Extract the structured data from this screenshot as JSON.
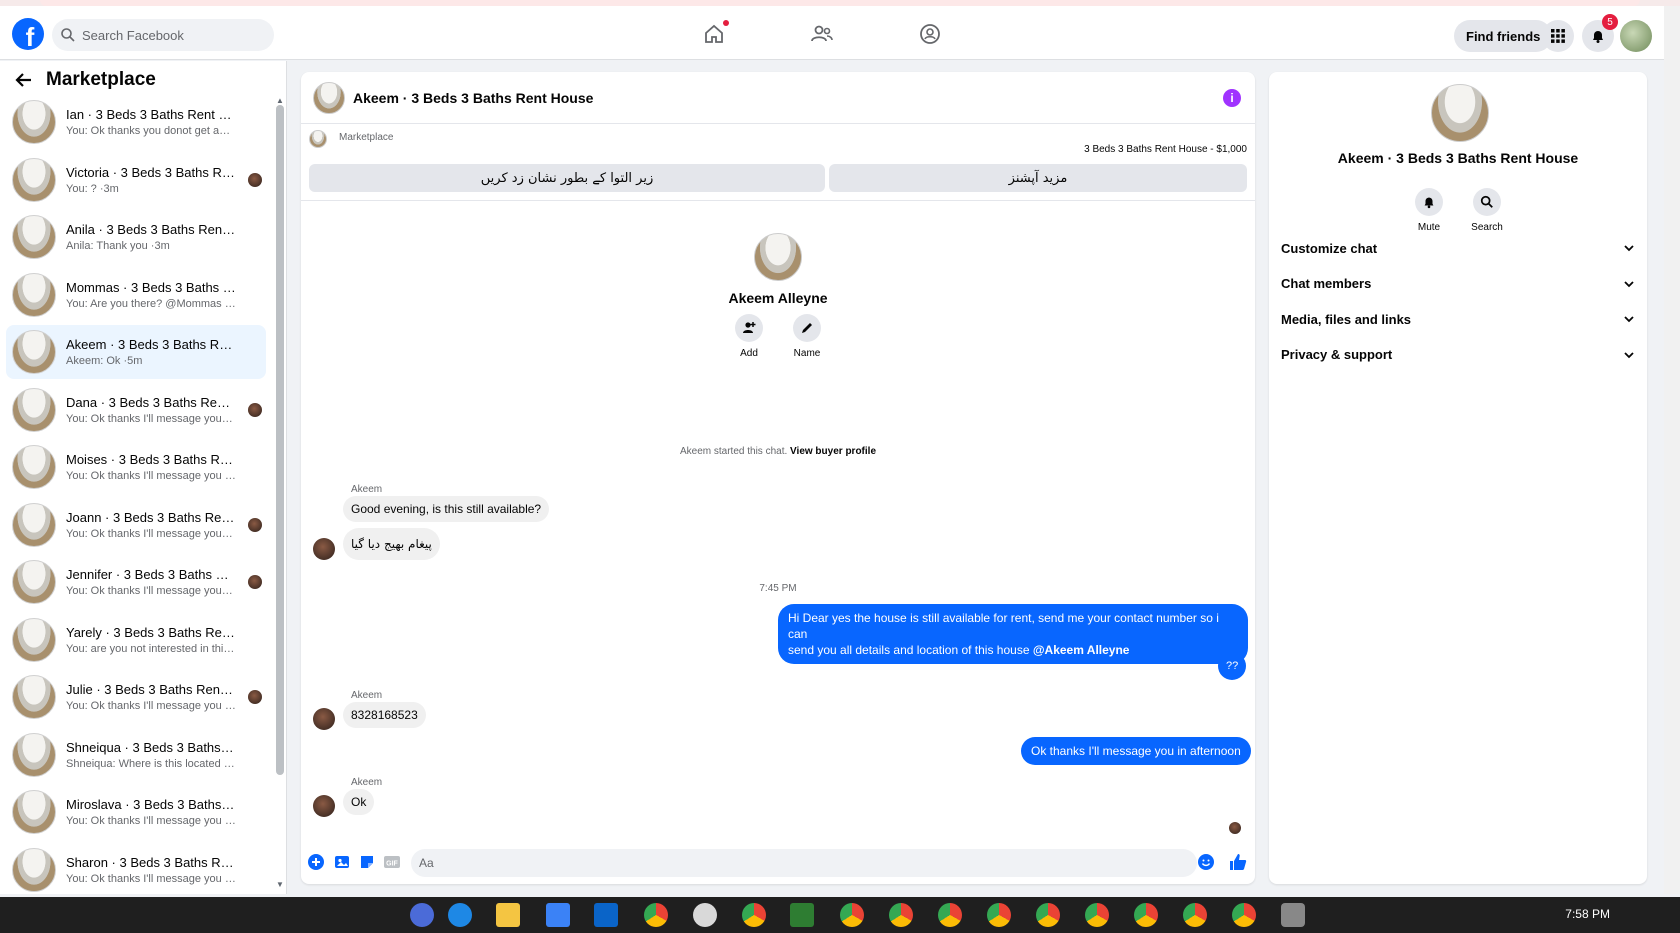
{
  "topnav": {
    "logo_letter": "f",
    "search_placeholder": "Search Facebook",
    "find_friends": "Find friends",
    "notifications_count": "5"
  },
  "left": {
    "title": "Marketplace",
    "conversations": [
      {
        "title": "Ian · 3 Beds 3 Baths Rent House",
        "preview": "You: Ok thanks you donot get any… ·2m",
        "active": false,
        "mini_avatar": false
      },
      {
        "title": "Victoria · 3 Beds 3 Baths Rent…",
        "preview": "You: ? ·3m",
        "active": false,
        "mini_avatar": true
      },
      {
        "title": "Anila · 3 Beds 3 Baths Rent House",
        "preview": "Anila: Thank you ·3m",
        "active": false,
        "mini_avatar": false
      },
      {
        "title": "Mommas · 3 Beds 3 Baths Rent …",
        "preview": "You: Are you there? @Mommas O… ·5m",
        "active": false,
        "mini_avatar": false
      },
      {
        "title": "Akeem · 3 Beds 3 Baths Rent H…",
        "preview": "Akeem: Ok ·5m",
        "active": true,
        "mini_avatar": false
      },
      {
        "title": "Dana · 3 Beds 3 Baths Rent H…",
        "preview": "You: Ok thanks I'll message you… ·9m",
        "active": false,
        "mini_avatar": true
      },
      {
        "title": "Moises · 3 Beds 3 Baths Rent H…",
        "preview": "You: Ok thanks I'll message you in… ·9m",
        "active": false,
        "mini_avatar": false
      },
      {
        "title": "Joann · 3 Beds 3 Baths Rent …",
        "preview": "You: Ok thanks I'll message you… ·7h",
        "active": false,
        "mini_avatar": true
      },
      {
        "title": "Jennifer · 3 Beds 3 Baths Rent…",
        "preview": "You: Ok thanks I'll message you… ·8h",
        "active": false,
        "mini_avatar": true
      },
      {
        "title": "Yarely · 3 Beds 3 Baths Rent Ho…",
        "preview": "You: are you not interested in this … ·9h",
        "active": false,
        "mini_avatar": false
      },
      {
        "title": "Julie · 3 Beds 3 Baths Rent Ho…",
        "preview": "You: Ok thanks I'll message you … ·9h",
        "active": false,
        "mini_avatar": true
      },
      {
        "title": "Shneiqua · 3 Beds 3 Baths Rent …",
        "preview": "Shneiqua: Where is this located ·9h",
        "active": false,
        "mini_avatar": false
      },
      {
        "title": "Miroslava · 3 Beds 3 Baths Rent …",
        "preview": "You: Ok thanks I'll message you in … ·9h",
        "active": false,
        "mini_avatar": false
      },
      {
        "title": "Sharon · 3 Beds 3 Baths Rent H…",
        "preview": "You: Ok thanks I'll message you in … ·9h",
        "active": false,
        "mini_avatar": false
      }
    ]
  },
  "chat": {
    "header_title": "Akeem · 3 Beds 3 Baths Rent House",
    "marketplace_label": "Marketplace",
    "listing_text": "3 Beds 3 Baths Rent House - $1,000",
    "btn_mark_pending": "زیر التوا کے بطور نشان زد کریں",
    "btn_more_options": "مزید آپشنز",
    "buyer_name": "Akeem Alleyne",
    "add_label": "Add",
    "name_label": "Name",
    "system_text": "Akeem started this chat.",
    "system_link": "View buyer profile",
    "sender_name": "Akeem",
    "msg1": "Good evening, is this still available?",
    "msg2": "پیغام بھیج دیا گیا",
    "time_divider": "7:45 PM",
    "msg3_line1": "Hi Dear yes the house is still available for rent, send me your contact number so i can",
    "msg3_line2": "send you all details and location of this house",
    "msg3_mention": "@Akeem Alleyne",
    "msg4": "??",
    "msg5": "8328168523",
    "msg6": "Ok thanks I'll message you in afternoon",
    "msg7": "Ok",
    "composer_placeholder": "Aa"
  },
  "right": {
    "name": "Akeem · 3 Beds 3 Baths Rent House",
    "mute_label": "Mute",
    "search_label": "Search",
    "rows": [
      "Customize chat",
      "Chat members",
      "Media, files and links",
      "Privacy & support"
    ]
  },
  "taskbar": {
    "clock": "7:58 PM"
  },
  "colors": {
    "brand_blue": "#0866ff",
    "active_bg": "#ebf5ff",
    "badge_red": "#e41e3f",
    "info_purple": "#a033ff"
  }
}
